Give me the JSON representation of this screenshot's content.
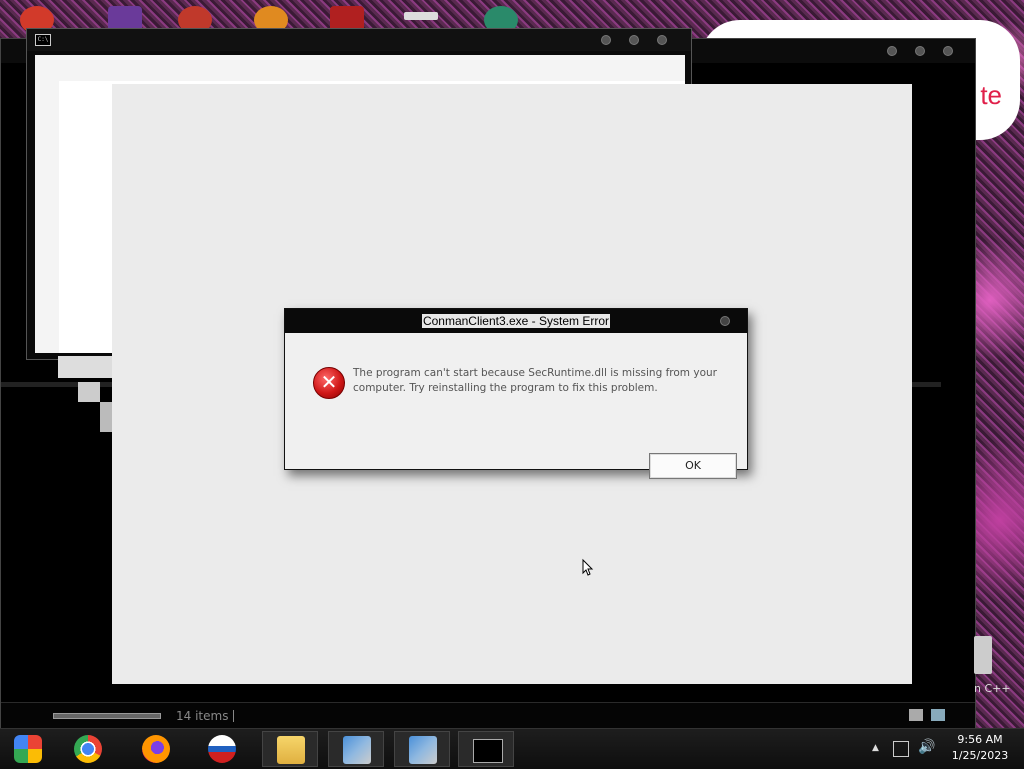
{
  "dialog": {
    "title": "ConmanClient3.exe - System Error",
    "message": "The program can't start because SecRuntime.dll is missing from your computer. Try reinstalling the program to fix this problem.",
    "ok_label": "OK",
    "icon": "error-x-icon"
  },
  "explorer": {
    "status_items": "14 items"
  },
  "console": {
    "icon_text": "C:\\"
  },
  "desktop": {
    "bubble_text": "te",
    "icon_label": "n C++"
  },
  "taskbar": {
    "items": [
      {
        "name": "Google Photos",
        "icon": "photos-icon"
      },
      {
        "name": "Google Chrome",
        "icon": "chrome-icon"
      },
      {
        "name": "Firefox",
        "icon": "firefox-icon"
      },
      {
        "name": "Windows Media",
        "icon": "media-icon"
      },
      {
        "name": "File Explorer",
        "icon": "folder-icon"
      },
      {
        "name": "Installer",
        "icon": "installer-icon"
      },
      {
        "name": "Installer",
        "icon": "installer-icon"
      },
      {
        "name": "Command Prompt",
        "icon": "cmd-icon"
      }
    ],
    "clock_time": "9:56 AM",
    "clock_date": "1/25/2023"
  },
  "colors": {
    "error_red": "#d01818",
    "dialog_bg": "#f0f0f0",
    "taskbar_bg": "#141414"
  }
}
